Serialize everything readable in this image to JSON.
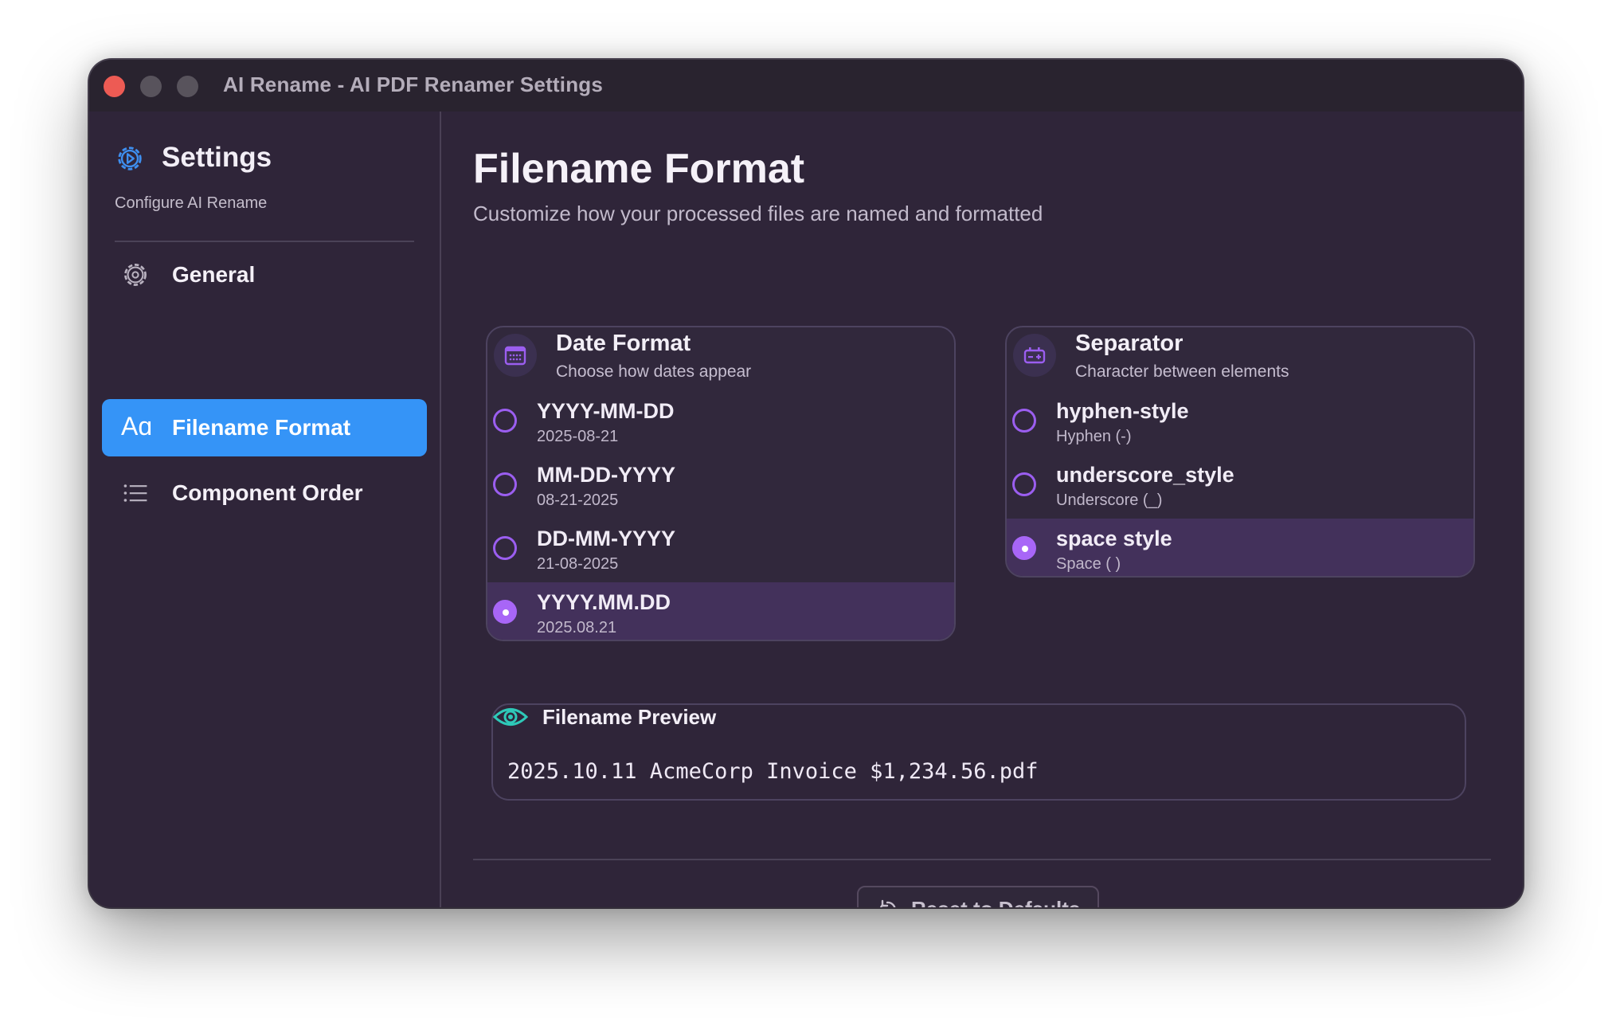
{
  "window": {
    "title": "AI Rename - AI PDF Renamer Settings"
  },
  "sidebar": {
    "title": "Settings",
    "subtitle": "Configure AI Rename",
    "items": [
      {
        "label": "General",
        "icon": "gear-icon",
        "active": false
      },
      {
        "label": "Filename Format",
        "icon": "text-format-icon",
        "icon_text": "Aɑ",
        "active": true
      },
      {
        "label": "Component Order",
        "icon": "list-icon",
        "active": false
      }
    ]
  },
  "main": {
    "title": "Filename Format",
    "subtitle": "Customize how your processed files are named and formatted",
    "date_format": {
      "title": "Date Format",
      "subtitle": "Choose how dates appear",
      "icon": "calendar-icon",
      "options": [
        {
          "label": "YYYY-MM-DD",
          "example": "2025-08-21",
          "selected": false
        },
        {
          "label": "MM-DD-YYYY",
          "example": "08-21-2025",
          "selected": false
        },
        {
          "label": "DD-MM-YYYY",
          "example": "21-08-2025",
          "selected": false
        },
        {
          "label": "YYYY.MM.DD",
          "example": "2025.08.21",
          "selected": true
        }
      ]
    },
    "separator": {
      "title": "Separator",
      "subtitle": "Character between elements",
      "icon": "separator-icon",
      "options": [
        {
          "label": "hyphen-style",
          "example": "Hyphen (-)",
          "selected": false
        },
        {
          "label": "underscore_style",
          "example": "Underscore (_)",
          "selected": false
        },
        {
          "label": "space style",
          "example": "Space ( )",
          "selected": true
        }
      ]
    },
    "preview": {
      "title": "Filename Preview",
      "icon": "eye-icon",
      "value": "2025.10.11 AcmeCorp Invoice $1,234.56.pdf"
    },
    "reset_label": "Reset to Defaults"
  },
  "colors": {
    "accent": "#3594f7",
    "radio": "#a866f7",
    "preview_icon": "#2ec9b8",
    "window_bg": "#2f2539"
  }
}
